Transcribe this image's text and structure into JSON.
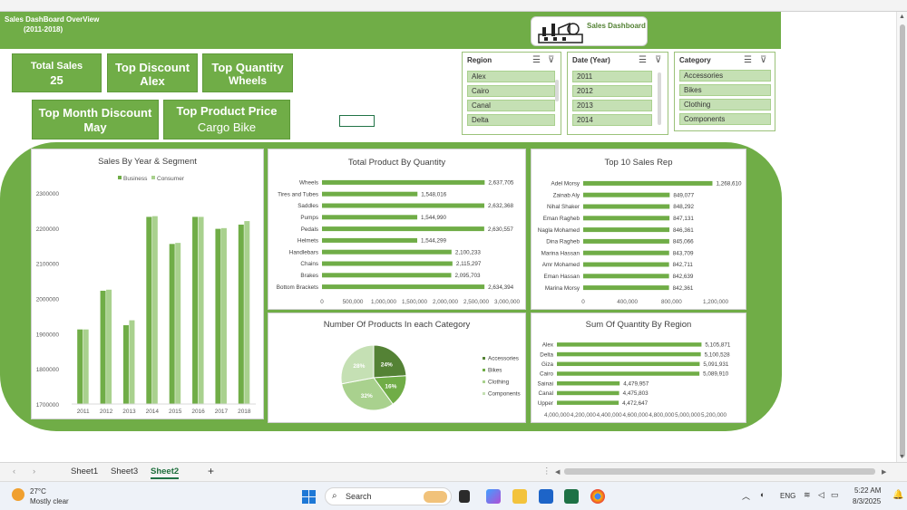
{
  "header": {
    "title": "Sales DashBoard OverView",
    "years": "(2011-2018)",
    "logo_text": "Sales Dashboard"
  },
  "kpis": {
    "total_sales": {
      "label": "Total Sales",
      "value": "25"
    },
    "top_discount": {
      "label": "Top Discount",
      "value": "Alex"
    },
    "top_quantity": {
      "label": "Top Quantity",
      "value": "Wheels"
    },
    "top_month_discount": {
      "label": "Top Month Discount",
      "value": "May"
    },
    "top_product_price": {
      "label": "Top Product Price",
      "value": "Cargo Bike"
    }
  },
  "slicers": {
    "region": {
      "title": "Region",
      "items": [
        "Alex",
        "Cairo",
        "Canal",
        "Delta"
      ]
    },
    "date": {
      "title": "Date (Year)",
      "items": [
        "2011",
        "2012",
        "2013",
        "2014"
      ]
    },
    "category": {
      "title": "Category",
      "items": [
        "Accessories",
        "Bikes",
        "Clothing",
        "Components"
      ]
    }
  },
  "charts": {
    "sales_by_year": {
      "title": "Sales By Year & Segment"
    },
    "product_qty": {
      "title": "Total Product By Quantity"
    },
    "top_reps": {
      "title": "Top 10 Sales Rep"
    },
    "category_pie": {
      "title": "Number Of Products In each Category"
    },
    "region_qty": {
      "title": "Sum Of Quantity By Region"
    }
  },
  "chart_data": [
    {
      "type": "bar",
      "title": "Sales By Year & Segment",
      "categories": [
        "2011",
        "2012",
        "2013",
        "2014",
        "2015",
        "2016",
        "2017",
        "2018"
      ],
      "series": [
        {
          "name": "Business",
          "values": [
            1912000,
            2022000,
            1924000,
            2232000,
            2155000,
            2232000,
            2198000,
            2210000
          ]
        },
        {
          "name": "Consumer",
          "values": [
            1912000,
            2025000,
            1938000,
            2234000,
            2158000,
            2232000,
            2200000,
            2220000
          ]
        }
      ],
      "ylim": [
        1700000,
        2300000
      ],
      "yticks": [
        "1700000",
        "1800000",
        "1900000",
        "2000000",
        "2100000",
        "2200000",
        "2300000"
      ],
      "legend": "top",
      "colors": [
        "#70ad47",
        "#a9d18e"
      ]
    },
    {
      "type": "bar",
      "orientation": "horizontal",
      "title": "Total Product By Quantity",
      "categories": [
        "Wheels",
        "Tires and Tubes",
        "Saddles",
        "Pumps",
        "Pedals",
        "Helmets",
        "Handlebars",
        "Chains",
        "Brakes",
        "Bottom Brackets"
      ],
      "values": [
        2637705,
        1548016,
        2632368,
        1544990,
        2630557,
        1544299,
        2100233,
        2115297,
        2095703,
        2634394
      ],
      "labels": [
        "2,637,705",
        "1,548,016",
        "2,632,368",
        "1,544,990",
        "2,630,557",
        "1,544,299",
        "2,100,233",
        "2,115,297",
        "2,095,703",
        "2,634,394"
      ],
      "xlim": [
        0,
        3000000
      ],
      "xticks": [
        "0",
        "500,000",
        "1,000,000",
        "1,500,000",
        "2,000,000",
        "2,500,000",
        "3,000,000"
      ]
    },
    {
      "type": "bar",
      "orientation": "horizontal",
      "title": "Top 10 Sales Rep",
      "categories": [
        "Adel Morsy",
        "Zainab Aly",
        "Nihal Shaker",
        "Eman Ragheb",
        "Nagla Mohamed",
        "Dina Ragheb",
        "Marina Hassan",
        "Amr Mohamed",
        "Eman Hassan",
        "Marina Morsy"
      ],
      "values": [
        1268610,
        849077,
        848292,
        847131,
        846361,
        845066,
        843709,
        842711,
        842639,
        842361
      ],
      "labels": [
        "1,268,610",
        "849,077",
        "848,292",
        "847,131",
        "846,361",
        "845,066",
        "843,709",
        "842,711",
        "842,639",
        "842,361"
      ],
      "xlim": [
        0,
        1300000
      ],
      "xticks": [
        "0",
        "400,000",
        "800,000",
        "1,200,000"
      ]
    },
    {
      "type": "pie",
      "title": "Number Of Products In each Category",
      "categories": [
        "Accessories",
        "Bikes",
        "Clothing",
        "Components"
      ],
      "values": [
        24,
        16,
        32,
        28
      ],
      "labels": [
        "24%",
        "16%",
        "32%",
        "28%"
      ],
      "colors": [
        "#548235",
        "#70ad47",
        "#a9d18e",
        "#c5e0b4"
      ],
      "legend": "right"
    },
    {
      "type": "bar",
      "orientation": "horizontal",
      "title": "Sum Of Quantity By Region",
      "categories": [
        "Alex",
        "Delta",
        "Giza",
        "Cairo",
        "Sainai",
        "Canal",
        "Upper"
      ],
      "values": [
        5105871,
        5100528,
        5091931,
        5089910,
        4479957,
        4475803,
        4472647
      ],
      "labels": [
        "5,105,871",
        "5,100,528",
        "5,091,931",
        "5,089,910",
        "4,479,957",
        "4,475,803",
        "4,472,647"
      ],
      "xlim": [
        4000000,
        5200000
      ],
      "xticks": [
        "4,000,000",
        "4,200,000",
        "4,400,000",
        "4,600,000",
        "4,800,000",
        "5,000,000",
        "5,200,000"
      ]
    }
  ],
  "sheet_tabs": [
    "Sheet1",
    "Sheet3",
    "Sheet2"
  ],
  "active_tab": "Sheet2",
  "taskbar": {
    "weather_temp": "27°C",
    "weather_desc": "Mostly clear",
    "search": "Search",
    "lang": "ENG",
    "time": "5:22 AM",
    "date": "8/3/2025"
  },
  "colors": {
    "accent": "#70ad47",
    "dark": "#548235",
    "light": "#a9d18e"
  }
}
